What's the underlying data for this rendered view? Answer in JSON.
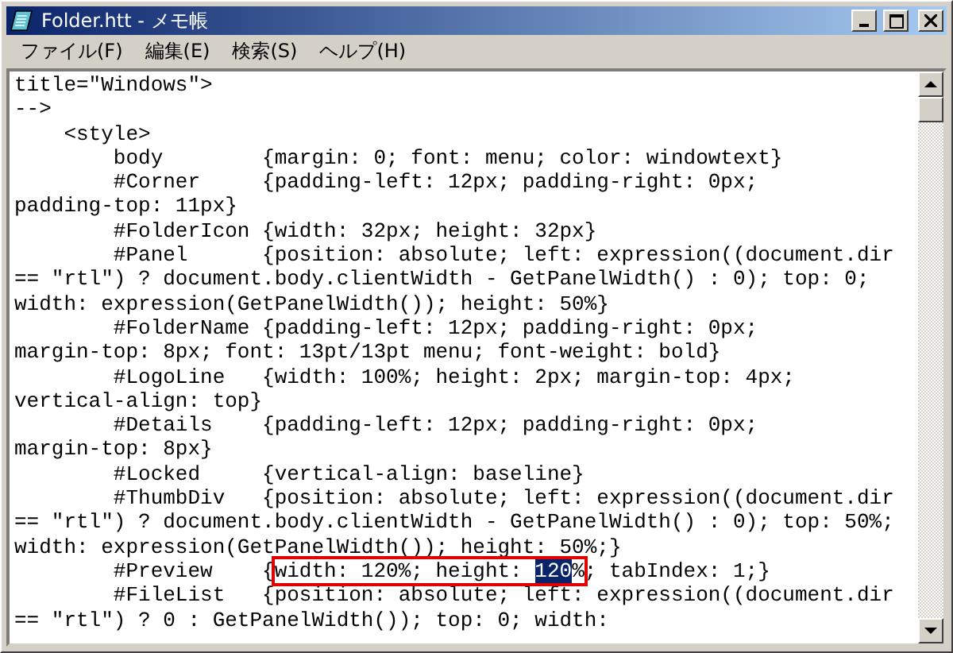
{
  "window": {
    "title": "Folder.htt - メモ帳"
  },
  "menu": [
    {
      "label": "ファイル(F)"
    },
    {
      "label": "編集(E)"
    },
    {
      "label": "検索(S)"
    },
    {
      "label": "ヘルプ(H)"
    }
  ],
  "lines": [
    {
      "parts": [
        {
          "kind": "plain",
          "text": "title=\"Windows\">"
        }
      ]
    },
    {
      "parts": [
        {
          "kind": "plain",
          "text": "-->"
        }
      ]
    },
    {
      "parts": [
        {
          "kind": "plain",
          "text": "    <style>"
        }
      ]
    },
    {
      "parts": [
        {
          "kind": "plain",
          "text": "        body        {margin: 0; font: menu; color: windowtext}"
        }
      ]
    },
    {
      "parts": [
        {
          "kind": "plain",
          "text": "        #Corner     {padding-left: 12px; padding-right: 0px;"
        }
      ]
    },
    {
      "parts": [
        {
          "kind": "plain",
          "text": "padding-top: 11px}"
        }
      ]
    },
    {
      "parts": [
        {
          "kind": "plain",
          "text": "        #FolderIcon {width: 32px; height: 32px}"
        }
      ]
    },
    {
      "parts": [
        {
          "kind": "plain",
          "text": "        #Panel      {position: absolute; left: expression((document.dir"
        }
      ]
    },
    {
      "parts": [
        {
          "kind": "plain",
          "text": "== \"rtl\") ? document.body.clientWidth - GetPanelWidth() : 0); top: 0;"
        }
      ]
    },
    {
      "parts": [
        {
          "kind": "plain",
          "text": "width: expression(GetPanelWidth()); height: 50%}"
        }
      ]
    },
    {
      "parts": [
        {
          "kind": "plain",
          "text": "        #FolderName {padding-left: 12px; padding-right: 0px;"
        }
      ]
    },
    {
      "parts": [
        {
          "kind": "plain",
          "text": "margin-top: 8px; font: 13pt/13pt menu; font-weight: bold}"
        }
      ]
    },
    {
      "parts": [
        {
          "kind": "plain",
          "text": "        #LogoLine   {width: 100%; height: 2px; margin-top: 4px;"
        }
      ]
    },
    {
      "parts": [
        {
          "kind": "plain",
          "text": "vertical-align: top}"
        }
      ]
    },
    {
      "parts": [
        {
          "kind": "plain",
          "text": "        #Details    {padding-left: 12px; padding-right: 0px;"
        }
      ]
    },
    {
      "parts": [
        {
          "kind": "plain",
          "text": "margin-top: 8px}"
        }
      ]
    },
    {
      "parts": [
        {
          "kind": "plain",
          "text": "        #Locked     {vertical-align: baseline}"
        }
      ]
    },
    {
      "parts": [
        {
          "kind": "plain",
          "text": "        #ThumbDiv   {position: absolute; left: expression((document.dir"
        }
      ]
    },
    {
      "parts": [
        {
          "kind": "plain",
          "text": "== \"rtl\") ? document.body.clientWidth - GetPanelWidth() : 0); top: 50%;"
        }
      ]
    },
    {
      "parts": [
        {
          "kind": "plain",
          "text": "width: expression(GetPanelWidth()); height: 50%;}"
        }
      ]
    },
    {
      "parts": [
        {
          "kind": "plain",
          "text": "        #Preview    {"
        },
        {
          "kind": "boxed",
          "parts": [
            {
              "kind": "plain",
              "text": "width: 120%; height: "
            },
            {
              "kind": "selection",
              "text": "120"
            },
            {
              "kind": "plain",
              "text": "%"
            }
          ]
        },
        {
          "kind": "plain",
          "text": "; tabIndex: 1;}"
        }
      ]
    },
    {
      "parts": [
        {
          "kind": "plain",
          "text": "        #FileList   {position: absolute; left: expression((document.dir"
        }
      ]
    },
    {
      "parts": [
        {
          "kind": "plain",
          "text": "== \"rtl\") ? 0 : GetPanelWidth()); top: 0; width:"
        }
      ]
    }
  ]
}
